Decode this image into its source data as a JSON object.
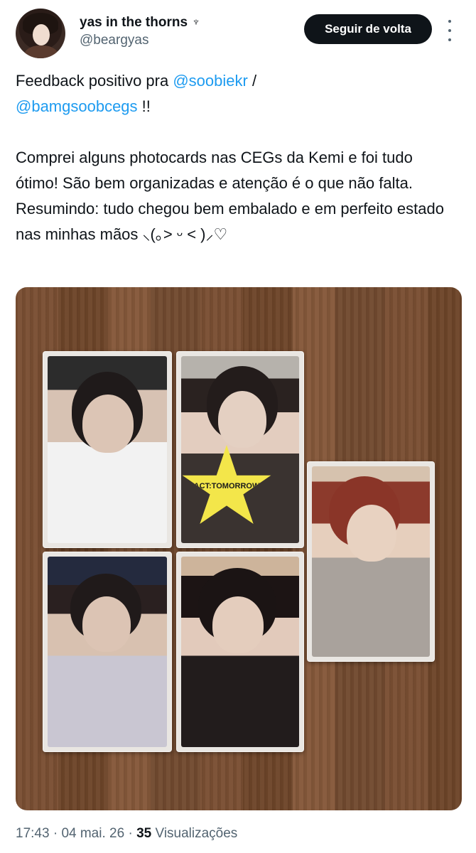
{
  "author": {
    "display_name": "yas in the thorns",
    "badge_glyph": "♆",
    "handle": "@beargyas"
  },
  "header": {
    "follow_label": "Seguir de volta"
  },
  "post": {
    "line1_prefix": "Feedback positivo pra ",
    "mention1": "@soobiekr",
    "line1_suffix": " /",
    "mention2": "@bamgsoobcegs",
    "line2_suffix": " !!",
    "paragraph2": "Comprei alguns photocards nas CEGs da Kemi e foi tudo ótimo! São bem organizadas e atenção é o que não falta.",
    "paragraph3": "Resumindo: tudo chegou bem embalado e em perfeito estado nas minhas mãos ⸜(｡> ᵕ < )⸝♡"
  },
  "photo": {
    "star_text": "ACT:TOMORROW"
  },
  "footer": {
    "time": "17:43",
    "date": "04 mai. 26",
    "views_count": "35",
    "views_label": "Visualizações",
    "separator": "·"
  },
  "colors": {
    "accent": "#1d9bf0",
    "text": "#0f1419",
    "secondary": "#536471",
    "button_bg": "#0f1419"
  }
}
